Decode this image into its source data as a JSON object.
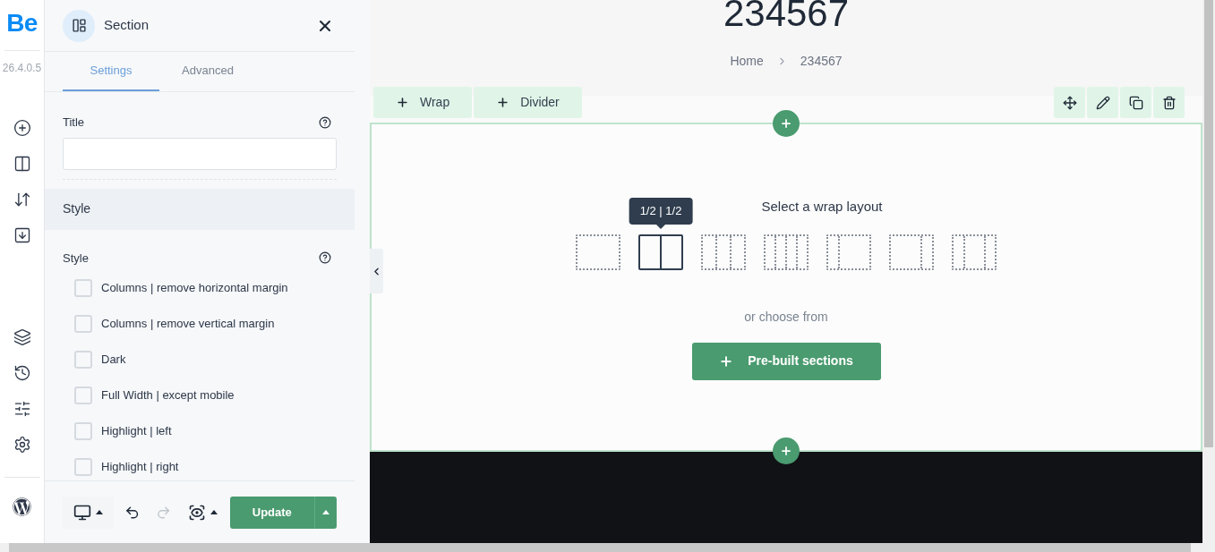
{
  "rail": {
    "logo": "Be",
    "version": "26.4.0.5"
  },
  "panel": {
    "title": "Section",
    "tabs": [
      {
        "label": "Settings",
        "selected": true
      },
      {
        "label": "Advanced",
        "selected": false
      }
    ],
    "title_field": {
      "label": "Title"
    },
    "group": "Style",
    "style_label": "Style",
    "options": [
      {
        "label": "Columns | remove horizontal margin",
        "checked": false
      },
      {
        "label": "Columns | remove vertical margin",
        "checked": false
      },
      {
        "label": "Dark",
        "checked": false
      },
      {
        "label": "Full Width | except mobile",
        "checked": false
      },
      {
        "label": "Highlight | left",
        "checked": false
      },
      {
        "label": "Highlight | right",
        "checked": false
      }
    ],
    "update_button": "Update"
  },
  "page": {
    "heading": "234567",
    "breadcrumb": [
      "Home",
      "234567"
    ],
    "add_buttons": [
      "Wrap",
      "Divider"
    ],
    "prompt": "Select a wrap layout",
    "layouts": [
      {
        "kind": "one",
        "selected": false
      },
      {
        "kind": "halves",
        "selected": true,
        "tooltip": "1/2 | 1/2"
      },
      {
        "kind": "thirds",
        "selected": false
      },
      {
        "kind": "quarters",
        "selected": false
      },
      {
        "kind": "narrow-left",
        "selected": false
      },
      {
        "kind": "narrow-right",
        "selected": false
      },
      {
        "kind": "wide-center",
        "selected": false
      }
    ],
    "alt_text": "or choose from",
    "prebuilt_button": "Pre-built sections"
  }
}
